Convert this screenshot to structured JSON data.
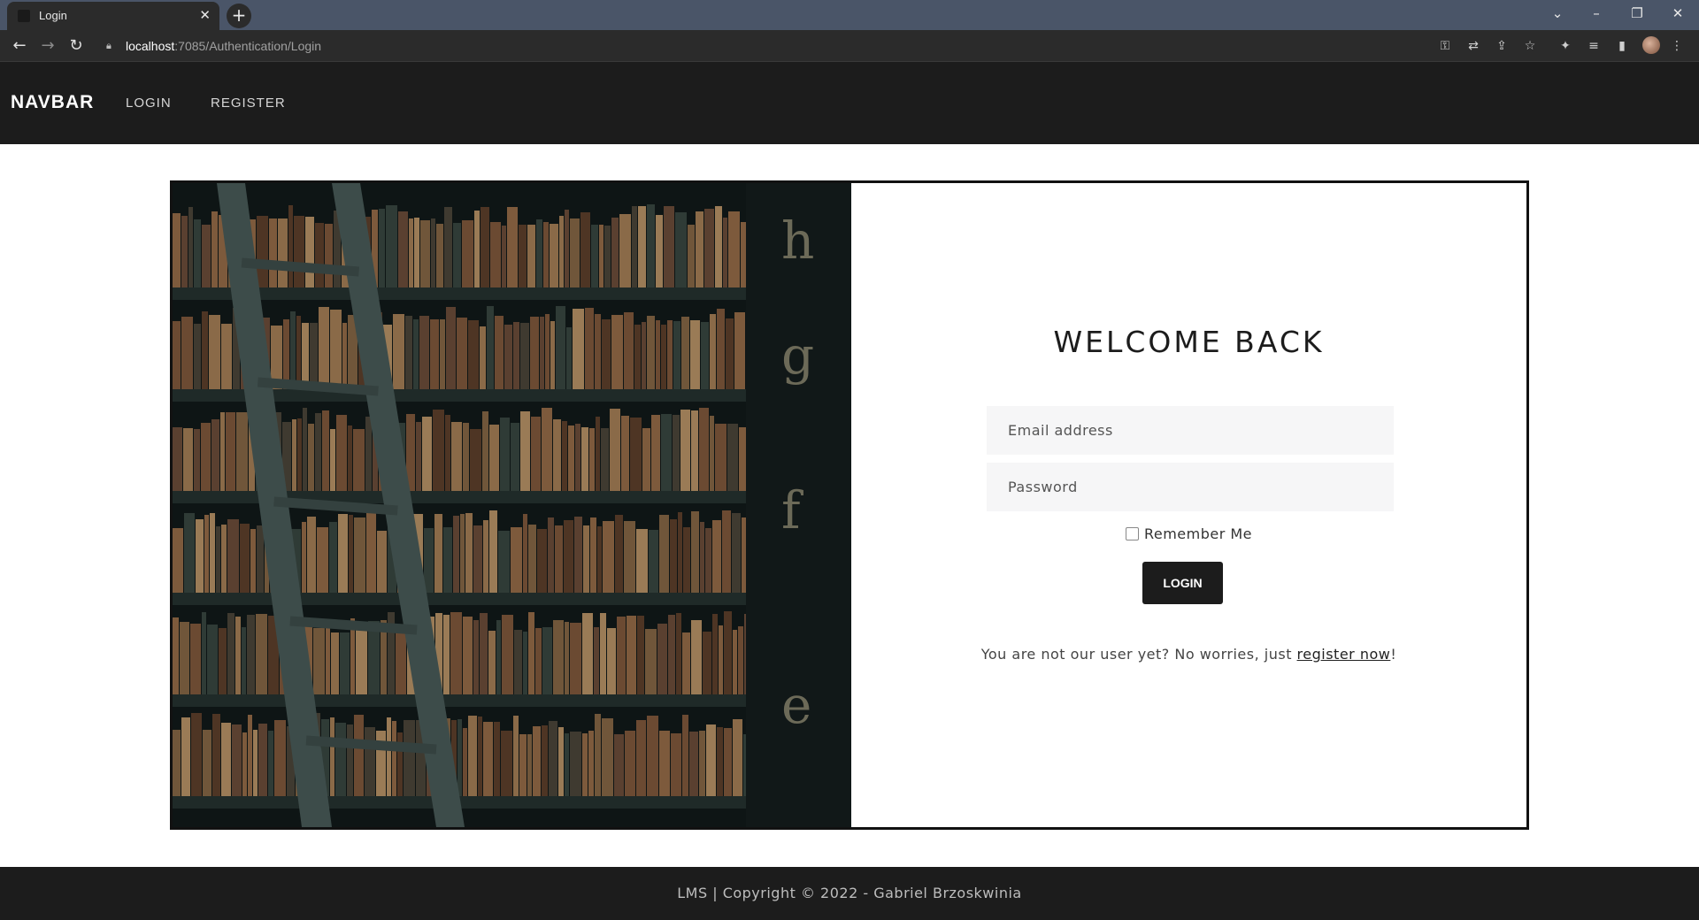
{
  "browser": {
    "tab_title": "Login",
    "tab_close": "✕",
    "new_tab": "+",
    "url_host": "localhost",
    "url_path": ":7085/Authentication/Login",
    "toolbar_icons": [
      "key-icon",
      "translate-icon",
      "share-icon",
      "star-icon",
      "extensions-icon",
      "reading-list-icon",
      "side-panel-icon",
      "profile-avatar"
    ]
  },
  "navbar": {
    "brand": "NAVBAR",
    "links": [
      {
        "label": "LOGIN"
      },
      {
        "label": "REGISTER"
      }
    ]
  },
  "hero": {
    "spine_letters": [
      "h",
      "g",
      "f",
      "e"
    ]
  },
  "login": {
    "title": "WELCOME BACK",
    "email_placeholder": "Email address",
    "password_placeholder": "Password",
    "remember_label": "Remember Me",
    "submit_label": "LOGIN",
    "register_prefix": "You are not our user yet? No worries, just ",
    "register_link": "register now",
    "register_suffix": "!"
  },
  "footer": {
    "text": "LMS | Copyright © 2022 - Gabriel Brzoskwinia"
  },
  "colors": {
    "navbar_bg": "#1c1c1c",
    "button_bg": "#1c1c1c",
    "input_bg": "#f6f6f7"
  }
}
